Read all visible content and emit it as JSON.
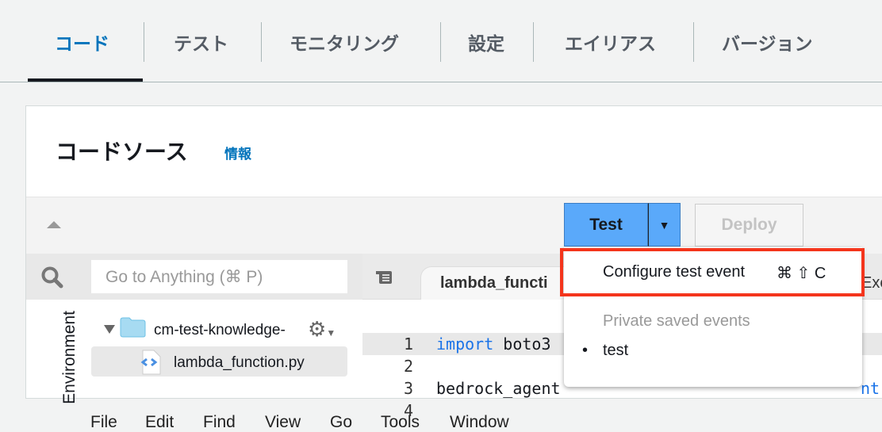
{
  "tabs": [
    {
      "label": "コード",
      "active": true
    },
    {
      "label": "テスト"
    },
    {
      "label": "モニタリング"
    },
    {
      "label": "設定"
    },
    {
      "label": "エイリアス"
    },
    {
      "label": "バージョン"
    }
  ],
  "section": {
    "title": "コードソース",
    "info_link": "情報"
  },
  "menu": [
    "File",
    "Edit",
    "Find",
    "View",
    "Go",
    "Tools",
    "Window"
  ],
  "buttons": {
    "test": "Test",
    "deploy": "Deploy"
  },
  "search": {
    "placeholder": "Go to Anything (⌘ P)"
  },
  "sidebar": {
    "env_label": "Environment",
    "folder": "cm-test-knowledge-",
    "file": "lambda_function.py"
  },
  "editor": {
    "tab": "lambda_functi",
    "tab2": "Exe",
    "lines": [
      {
        "n": "1",
        "kw": "import",
        "rest": " boto3"
      },
      {
        "n": "2",
        "text": ""
      },
      {
        "n": "3",
        "text": "bedrock_agent",
        "tail": "nt("
      },
      {
        "n": "4",
        "text": ""
      }
    ]
  },
  "dropdown": {
    "configure": "Configure test event",
    "shortcut": "⌘ ⇧ C",
    "section": "Private saved events",
    "events": [
      "test"
    ]
  },
  "colors": {
    "accent": "#0073bb",
    "test_button": "#5aa9fa",
    "highlight": "#f4351c"
  }
}
